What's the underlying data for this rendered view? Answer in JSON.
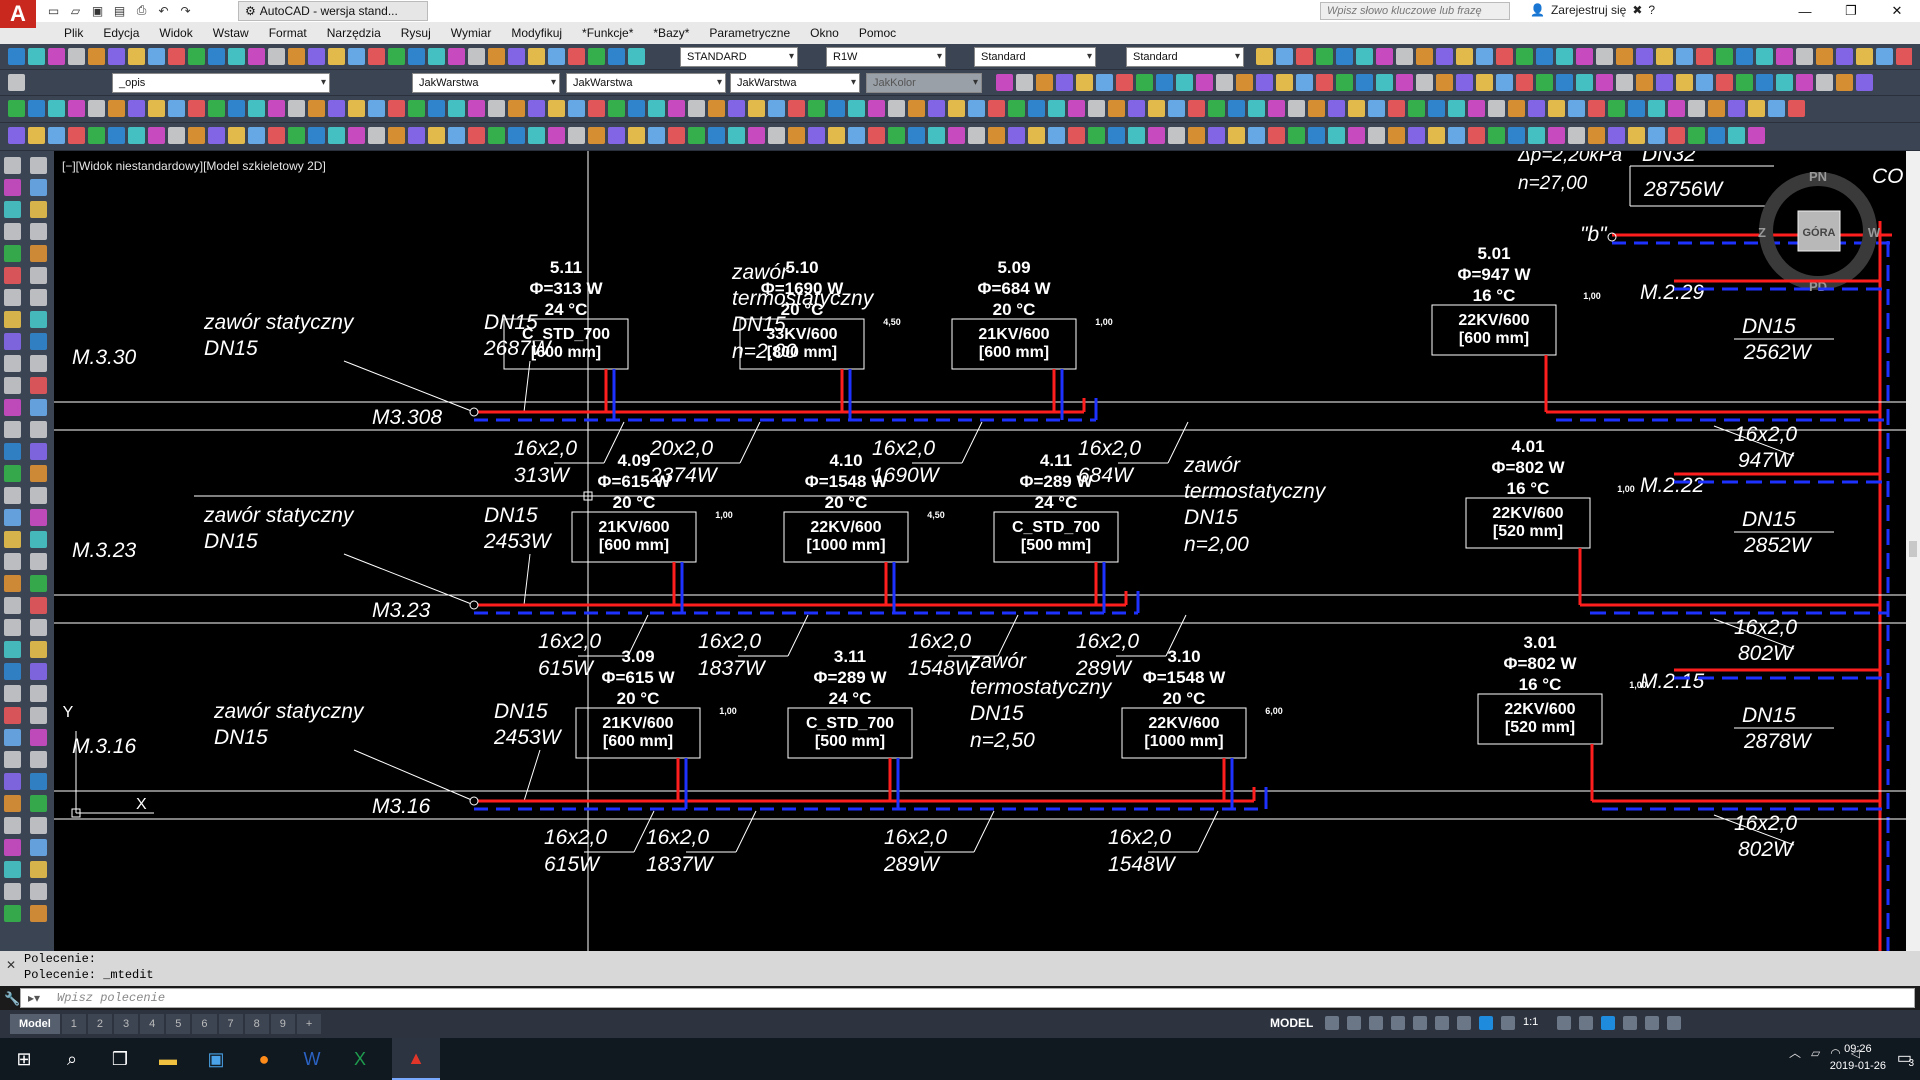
{
  "window": {
    "title": "AutoCAD - wersja stand...",
    "search_placeholder": "Wpisz słowo kluczowe lub frazę",
    "sign_in": "Zarejestruj się"
  },
  "menu": [
    "Plik",
    "Edycja",
    "Widok",
    "Wstaw",
    "Format",
    "Narzędzia",
    "Rysuj",
    "Wymiar",
    "Modyfikuj",
    "*Funkcje*",
    "*Bazy*",
    "Parametryczne",
    "Okno",
    "Pomoc"
  ],
  "toolbar": {
    "text_style": "STANDARD",
    "dim_style": "R1W",
    "table_style": "Standard",
    "mleader_style": "Standard",
    "layer": "_opis",
    "color": "JakWarstwa",
    "linetype": "JakWarstwa",
    "lineweight": "JakWarstwa",
    "plot_style": "JakKolor"
  },
  "viewport": {
    "label": "[−][Widok niestandardowy][Model szkieletowy 2D]",
    "viewcube": {
      "top": "GÓRA",
      "north": "PN",
      "south": "PD",
      "west": "Z",
      "east": "W"
    }
  },
  "drawing": {
    "top_fragment": {
      "dp": "Δp=2,20kPa",
      "n": "n=27,00",
      "dn": "DN32",
      "power": "28756W",
      "b": "\"b\"",
      "co": "CO"
    },
    "rows": [
      {
        "riser": "M.3.30",
        "pipe_label": "M3.308",
        "static_valve": [
          "zawór statyczny",
          "DN15"
        ],
        "static_dn": "DN15",
        "static_power": "2687W",
        "thermo_valve": [
          "zawór",
          "termostatyczny",
          "DN15",
          "n=2,00"
        ],
        "rooms": [
          {
            "id": "5.11",
            "phi": "Φ=313 W",
            "temp": "24 °C",
            "rad": "C_STD_700",
            "size": "[600 mm]"
          },
          {
            "id": "5.10",
            "phi": "Φ=1690 W",
            "temp": "20 °C",
            "rad": "33KV/600",
            "size": "[800 mm]",
            "coef": "4,50"
          },
          {
            "id": "5.09",
            "phi": "Φ=684 W",
            "temp": "20 °C",
            "rad": "21KV/600",
            "size": "[600 mm]",
            "coef": "1,00"
          }
        ],
        "pipes": [
          [
            "16x2,0",
            "313W"
          ],
          [
            "20x2,0",
            "2374W"
          ],
          [
            "16x2,0",
            "1690W"
          ],
          [
            "16x2,0",
            "684W"
          ]
        ],
        "right": {
          "id": "5.01",
          "phi": "Φ=947 W",
          "temp": "16 °C",
          "rad": "22KV/600",
          "size": "[600 mm]",
          "coef": "1,00",
          "riser": "M.2.29",
          "dn": "DN15",
          "power": "2562W",
          "pipe": "16x2,0",
          "pipe_power": "947W"
        }
      },
      {
        "riser": "M.3.23",
        "pipe_label": "M3.23",
        "static_valve": [
          "zawór statyczny",
          "DN15"
        ],
        "static_dn": "DN15",
        "static_power": "2453W",
        "thermo_valve": [
          "zawór",
          "termostatyczny",
          "DN15",
          "n=2,00"
        ],
        "rooms": [
          {
            "id": "4.09",
            "phi": "Φ=615 W",
            "temp": "20 °C",
            "rad": "21KV/600",
            "size": "[600 mm]",
            "coef": "1,00"
          },
          {
            "id": "4.10",
            "phi": "Φ=1548 W",
            "temp": "20 °C",
            "rad": "22KV/600",
            "size": "[1000 mm]",
            "coef": "4,50"
          },
          {
            "id": "4.11",
            "phi": "Φ=289 W",
            "temp": "24 °C",
            "rad": "C_STD_700",
            "size": "[500 mm]"
          }
        ],
        "pipes": [
          [
            "16x2,0",
            "615W"
          ],
          [
            "16x2,0",
            "1837W"
          ],
          [
            "16x2,0",
            "1548W"
          ],
          [
            "16x2,0",
            "289W"
          ]
        ],
        "right": {
          "id": "4.01",
          "phi": "Φ=802 W",
          "temp": "16 °C",
          "rad": "22KV/600",
          "size": "[520 mm]",
          "coef": "1,00",
          "riser": "M.2.22",
          "dn": "DN15",
          "power": "2852W",
          "pipe": "16x2,0",
          "pipe_power": "802W"
        }
      },
      {
        "riser": "M.3.16",
        "pipe_label": "M3.16",
        "static_valve": [
          "zawór statyczny",
          "DN15"
        ],
        "static_dn": "DN15",
        "static_power": "2453W",
        "thermo_valve": [
          "zawór",
          "termostatyczny",
          "DN15",
          "n=2,50"
        ],
        "rooms": [
          {
            "id": "3.09",
            "phi": "Φ=615 W",
            "temp": "20 °C",
            "rad": "21KV/600",
            "size": "[600 mm]",
            "coef": "1,00"
          },
          {
            "id": "3.11",
            "phi": "Φ=289 W",
            "temp": "24 °C",
            "rad": "C_STD_700",
            "size": "[500 mm]"
          },
          {
            "id": "3.10",
            "phi": "Φ=1548 W",
            "temp": "20 °C",
            "rad": "22KV/600",
            "size": "[1000 mm]",
            "coef": "6,00"
          }
        ],
        "pipes": [
          [
            "16x2,0",
            "615W"
          ],
          [
            "16x2,0",
            "1837W"
          ],
          [
            "16x2,0",
            "289W"
          ],
          [
            "16x2,0",
            "1548W"
          ]
        ],
        "right": {
          "id": "3.01",
          "phi": "Φ=802 W",
          "temp": "16 °C",
          "rad": "22KV/600",
          "size": "[520 mm]",
          "coef": "1,00",
          "riser": "M.2.15",
          "dn": "DN15",
          "power": "2878W",
          "pipe": "16x2,0",
          "pipe_power": "802W"
        }
      }
    ],
    "ucs": {
      "x": "X",
      "y": "Y"
    }
  },
  "command": {
    "history": [
      "Polecenie:",
      "Polecenie: _mtedit"
    ],
    "placeholder": "Wpisz polecenie"
  },
  "layout_tabs": [
    "Model",
    "1",
    "2",
    "3",
    "4",
    "5",
    "6",
    "7",
    "8",
    "9",
    "+"
  ],
  "status": {
    "mode": "MODEL",
    "scale": "1:1"
  },
  "taskbar": {
    "time": "09:26",
    "date": "2019-01-26",
    "notifications": "3"
  },
  "colors": {
    "supply": "#ff1e1e",
    "return": "#1e32ff",
    "canvas": "#000000",
    "lines": "#ffffff"
  }
}
